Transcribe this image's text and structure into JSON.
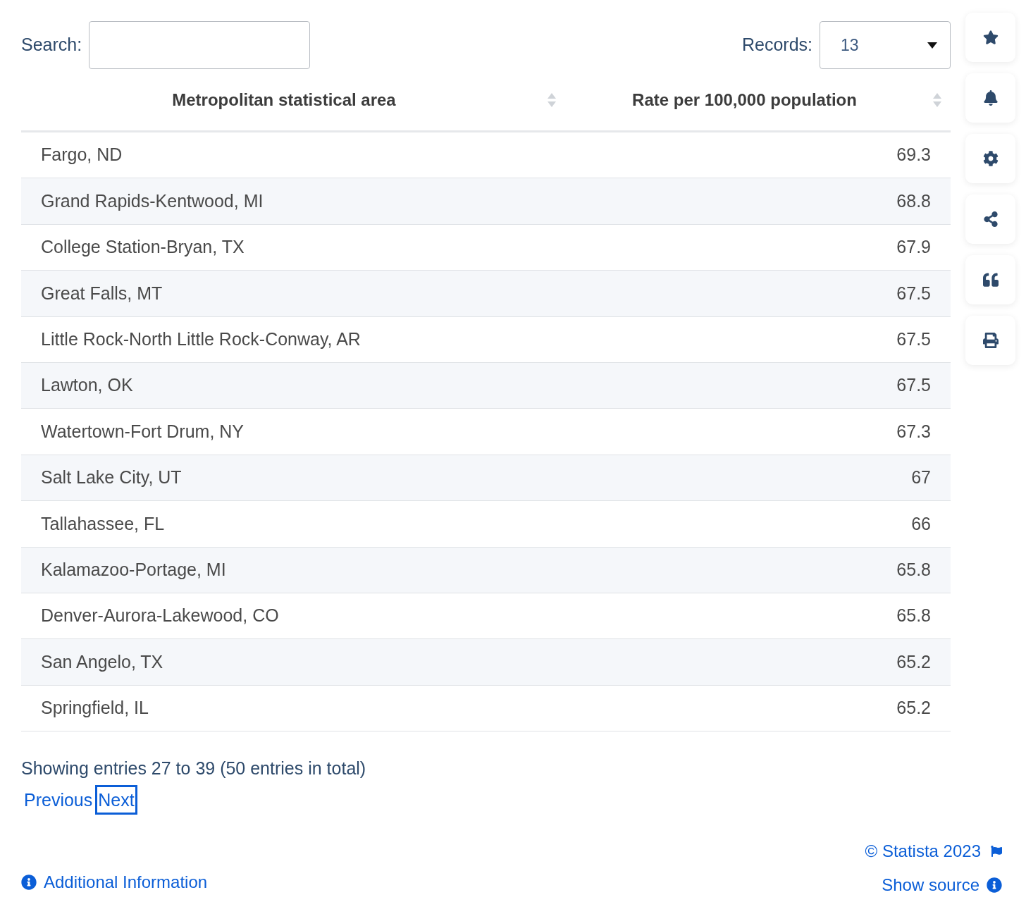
{
  "search": {
    "label": "Search:"
  },
  "records": {
    "label": "Records:",
    "value": "13"
  },
  "table": {
    "columns": [
      "Metropolitan statistical area",
      "Rate per 100,000 population"
    ],
    "rows": [
      {
        "area": "Fargo, ND",
        "rate": "69.3"
      },
      {
        "area": "Grand Rapids-Kentwood, MI",
        "rate": "68.8"
      },
      {
        "area": "College Station-Bryan, TX",
        "rate": "67.9"
      },
      {
        "area": "Great Falls, MT",
        "rate": "67.5"
      },
      {
        "area": "Little Rock-North Little Rock-Conway, AR",
        "rate": "67.5"
      },
      {
        "area": "Lawton, OK",
        "rate": "67.5"
      },
      {
        "area": "Watertown-Fort Drum, NY",
        "rate": "67.3"
      },
      {
        "area": "Salt Lake City, UT",
        "rate": "67"
      },
      {
        "area": "Tallahassee, FL",
        "rate": "66"
      },
      {
        "area": "Kalamazoo-Portage, MI",
        "rate": "65.8"
      },
      {
        "area": "Denver-Aurora-Lakewood, CO",
        "rate": "65.8"
      },
      {
        "area": "San Angelo, TX",
        "rate": "65.2"
      },
      {
        "area": "Springfield, IL",
        "rate": "65.2"
      }
    ]
  },
  "info": "Showing entries 27 to 39 (50 entries in total)",
  "pagination": [
    {
      "label": "Previous",
      "focused": false
    },
    {
      "label": "Next",
      "focused": true
    }
  ],
  "sidebar": [
    {
      "kind": "star"
    },
    {
      "kind": "bell"
    },
    {
      "kind": "gear"
    },
    {
      "kind": "share"
    },
    {
      "kind": "quote"
    },
    {
      "kind": "print"
    }
  ],
  "footer": {
    "additional_info": "Additional Information",
    "copyright": "© Statista 2023",
    "show_source": "Show source"
  }
}
